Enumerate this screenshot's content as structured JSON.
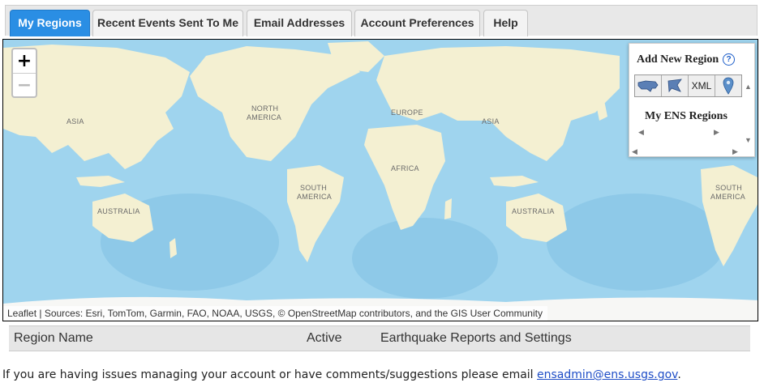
{
  "tabs": [
    {
      "label": "My Regions",
      "active": true
    },
    {
      "label": "Recent Events Sent To Me",
      "active": false
    },
    {
      "label": "Email Addresses",
      "active": false
    },
    {
      "label": "Account Preferences",
      "active": false
    },
    {
      "label": "Help",
      "active": false
    }
  ],
  "map": {
    "zoom_in": "+",
    "zoom_out": "−",
    "labels": [
      "ASIA",
      "NORTH",
      "AMERICA",
      "EUROPE",
      "ASIA",
      "AFRICA",
      "SOUTH",
      "AMERICA",
      "AUSTRALIA",
      "AUSTRALIA",
      "SOUTH",
      "AMERICA"
    ],
    "attribution": "Leaflet | Sources: Esri, TomTom, Garmin, FAO, NOAA, USGS, © OpenStreetMap contributors, and the GIS User Community"
  },
  "region_panel": {
    "title": "Add New Region",
    "help_icon": "?",
    "tools": [
      {
        "icon": "us-map-icon",
        "label": ""
      },
      {
        "icon": "polygon-icon",
        "label": ""
      },
      {
        "icon": "xml-icon",
        "label": "XML"
      },
      {
        "icon": "map-pin-icon",
        "label": ""
      }
    ],
    "my_regions_title": "My ENS Regions"
  },
  "table": {
    "columns": [
      "Region Name",
      "Active",
      "Earthquake Reports and Settings"
    ]
  },
  "footer": {
    "text": "If you are having issues managing your account or have comments/suggestions please email ",
    "email": "ensadmin@ens.usgs.gov",
    "trailing": "."
  },
  "colors": {
    "tab_active": "#2a8ee4",
    "ocean": "#9fd4ee",
    "land": "#f4f0d2",
    "link": "#1f4ec7"
  }
}
